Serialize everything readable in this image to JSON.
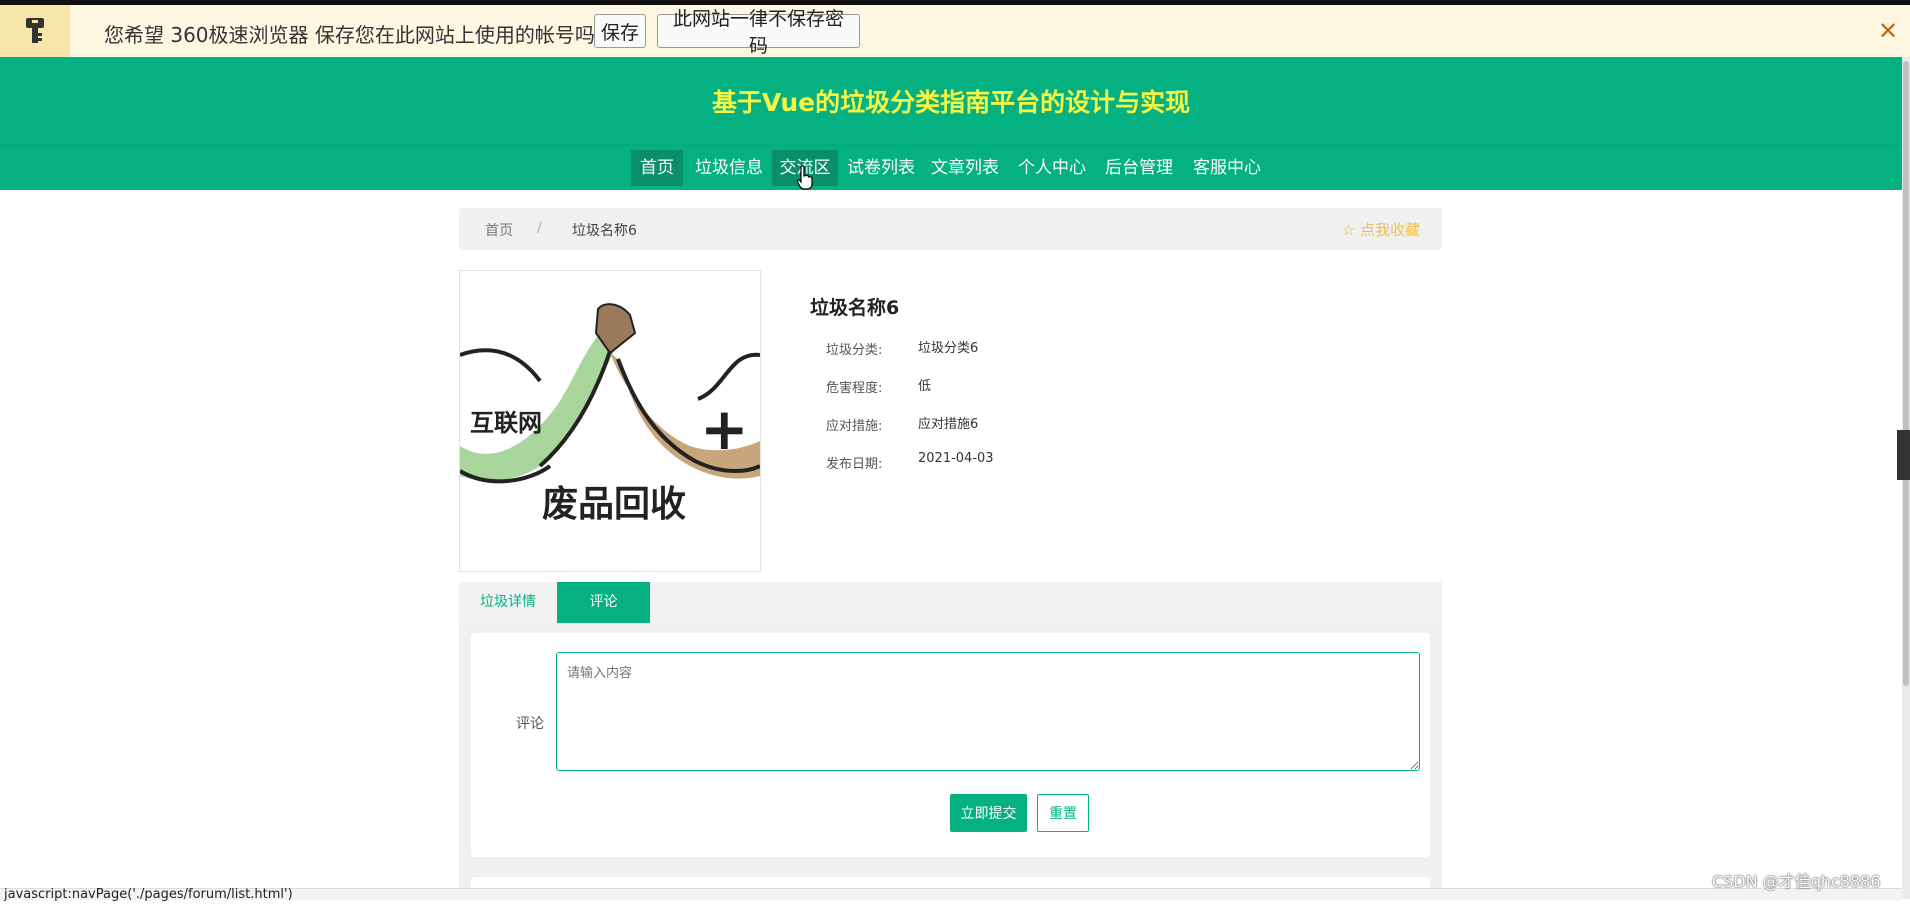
{
  "password_bar": {
    "message": "您希望 360极速浏览器 保存您在此网站上使用的帐号吗?",
    "save_label": "保存",
    "never_label": "此网站一律不保存密码",
    "close_label": "✕"
  },
  "header": {
    "title": "基于Vue的垃圾分类指南平台的设计与实现"
  },
  "nav": {
    "items": [
      {
        "label": "首页",
        "active": true
      },
      {
        "label": "垃圾信息",
        "active": false
      },
      {
        "label": "交流区",
        "active": false,
        "hovered": true
      },
      {
        "label": "试卷列表",
        "active": false
      },
      {
        "label": "文章列表",
        "active": false
      },
      {
        "label": "个人中心",
        "active": false
      },
      {
        "label": "后台管理",
        "active": false
      },
      {
        "label": "客服中心",
        "active": false
      }
    ]
  },
  "breadcrumb": {
    "home": "首页",
    "separator": "/",
    "current": "垃圾名称6",
    "favorite": "☆ 点我收藏"
  },
  "product": {
    "name": "垃圾名称6",
    "image_text": {
      "left": "互联网",
      "plus": "+",
      "bottom": "废品回收"
    },
    "fields": [
      {
        "label": "垃圾分类:",
        "value": "垃圾分类6"
      },
      {
        "label": "危害程度:",
        "value": "低"
      },
      {
        "label": "应对措施:",
        "value": "应对措施6"
      },
      {
        "label": "发布日期:",
        "value": "2021-04-03"
      }
    ]
  },
  "tabs": [
    {
      "label": "垃圾详情",
      "active": false
    },
    {
      "label": "评论",
      "active": true
    }
  ],
  "comment": {
    "label": "评论",
    "placeholder": "请输入内容",
    "submit": "立即提交",
    "reset": "重置"
  },
  "status_bar": {
    "url": "javascript:navPage('./pages/forum/list.html')"
  },
  "watermark": "CSDN @才佳qhc8886",
  "colors": {
    "primary": "#05b181",
    "title_yellow": "#f2f545",
    "favorite": "#eec04b"
  },
  "icons": {
    "password": "key-icon",
    "favorite": "star-icon",
    "close": "close-icon"
  }
}
